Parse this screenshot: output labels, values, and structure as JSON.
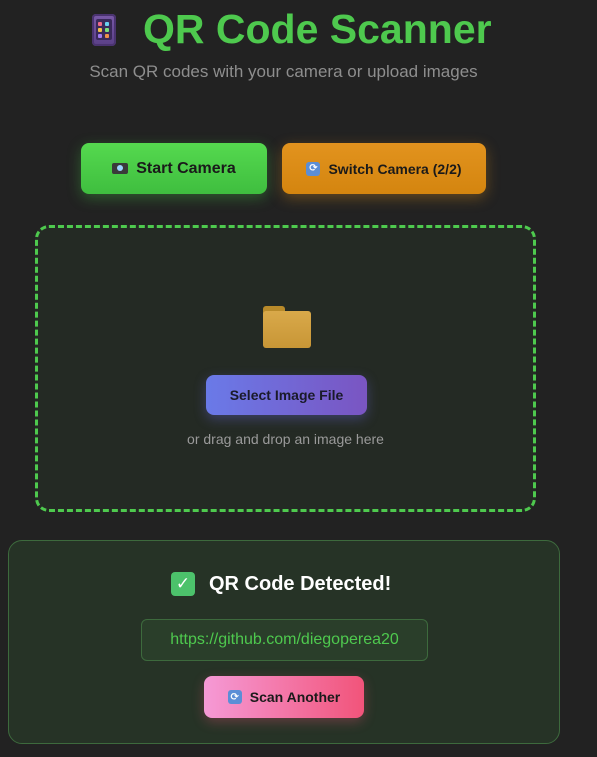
{
  "header": {
    "title": "QR Code Scanner",
    "subtitle": "Scan QR codes with your camera or upload images",
    "icon": "mobile-phone-icon"
  },
  "controls": {
    "start_camera_label": "Start Camera",
    "start_camera_icon": "camera-icon",
    "switch_camera_label": "Switch Camera (2/2)",
    "switch_camera_icon": "cycle-arrows-icon"
  },
  "upload": {
    "icon": "folder-icon",
    "select_label": "Select Image File",
    "hint": "or drag and drop an image here"
  },
  "result": {
    "icon": "check-mark-icon",
    "title": "QR Code Detected!",
    "url": "https://github.com/diegoperea20",
    "scan_another_label": "Scan Another",
    "scan_another_icon": "cycle-arrows-icon"
  },
  "colors": {
    "background": "#222222",
    "accent_green": "#4ec94e",
    "switch_orange": "#e2931e",
    "select_purple": "#6a7ae8",
    "scan_another_pink": "#f2547a"
  }
}
